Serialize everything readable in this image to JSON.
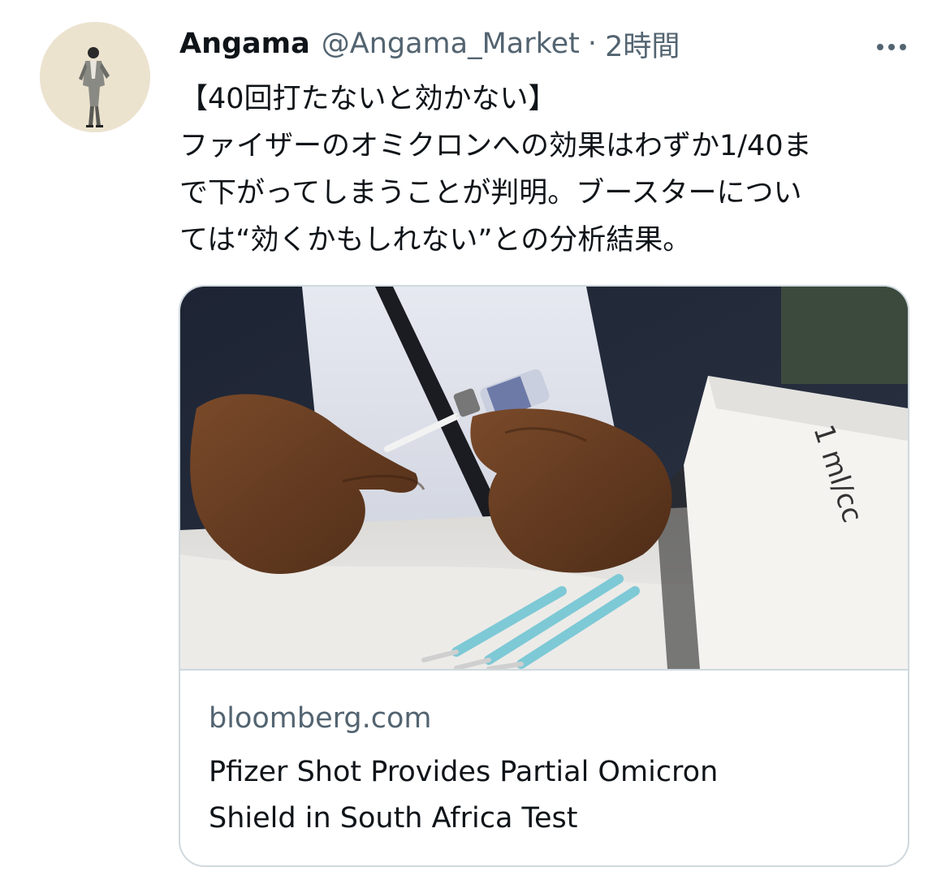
{
  "tweet": {
    "author": {
      "display_name": "Angama",
      "handle": "@Angama_Market",
      "separator": "·",
      "time": "2時間"
    },
    "more_icon": "more-horizontal-icon",
    "text_lines": [
      "【40回打たないと効かない】",
      "ファイザーのオミクロンへの効果はわずか1/40ま",
      "で下がってしまうことが判明。ブースターについ",
      "ては“効くかもしれない”との分析結果。"
    ],
    "card": {
      "domain": "bloomberg.com",
      "title_lines": [
        "Pfizer Shot Provides Partial Omicron",
        "Shield in South Africa Test"
      ],
      "image_text": "1 ml/cc"
    }
  },
  "colors": {
    "text_primary": "#0f1419",
    "text_secondary": "#536471",
    "border": "#cfd9de",
    "avatar_bg": "#ece3cf"
  }
}
